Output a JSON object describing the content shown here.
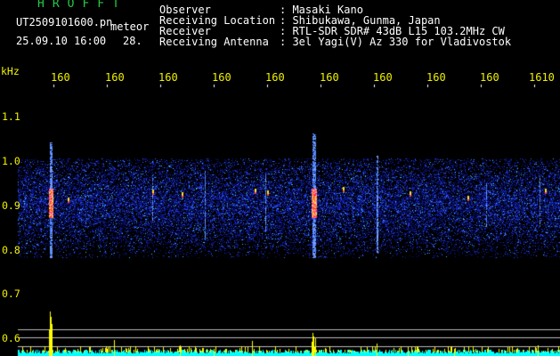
{
  "header": {
    "logo": "HROFFT",
    "file_name": "UT2509101600.pn",
    "mode_label": "meteor",
    "date_time": "25.09.10 16:00",
    "count": "28.",
    "info_rows": [
      {
        "label": "Observer",
        "value": ": Masaki Kano"
      },
      {
        "label": "Receiving Location",
        "value": ": Shibukawa, Gunma, Japan"
      },
      {
        "label": "Receiver",
        "value": ": RTL-SDR SDR# 43dB L15 103.2MHz CW"
      },
      {
        "label": "Receiving Antenna",
        "value": ": 3el Yagi(V) Az 330 for Vladivostok"
      }
    ]
  },
  "axis": {
    "y_unit": "kHz",
    "y_ticks": [
      "1.1",
      "1.0",
      "0.9",
      "0.8",
      "0.7",
      "0.6"
    ],
    "x_ticks": [
      "160",
      "160",
      "160",
      "160",
      "160",
      "160",
      "160",
      "160",
      "160",
      "1610"
    ]
  },
  "colors": {
    "background": "#000000",
    "text": "#ffffff",
    "axis_labels": "#f0f000",
    "logo": "#22cc44",
    "noise_base": "#1a2fd0",
    "meteor_hot": "#ff3030",
    "baseline": "#00ffff",
    "signal_peaks": "#ffff00"
  }
}
